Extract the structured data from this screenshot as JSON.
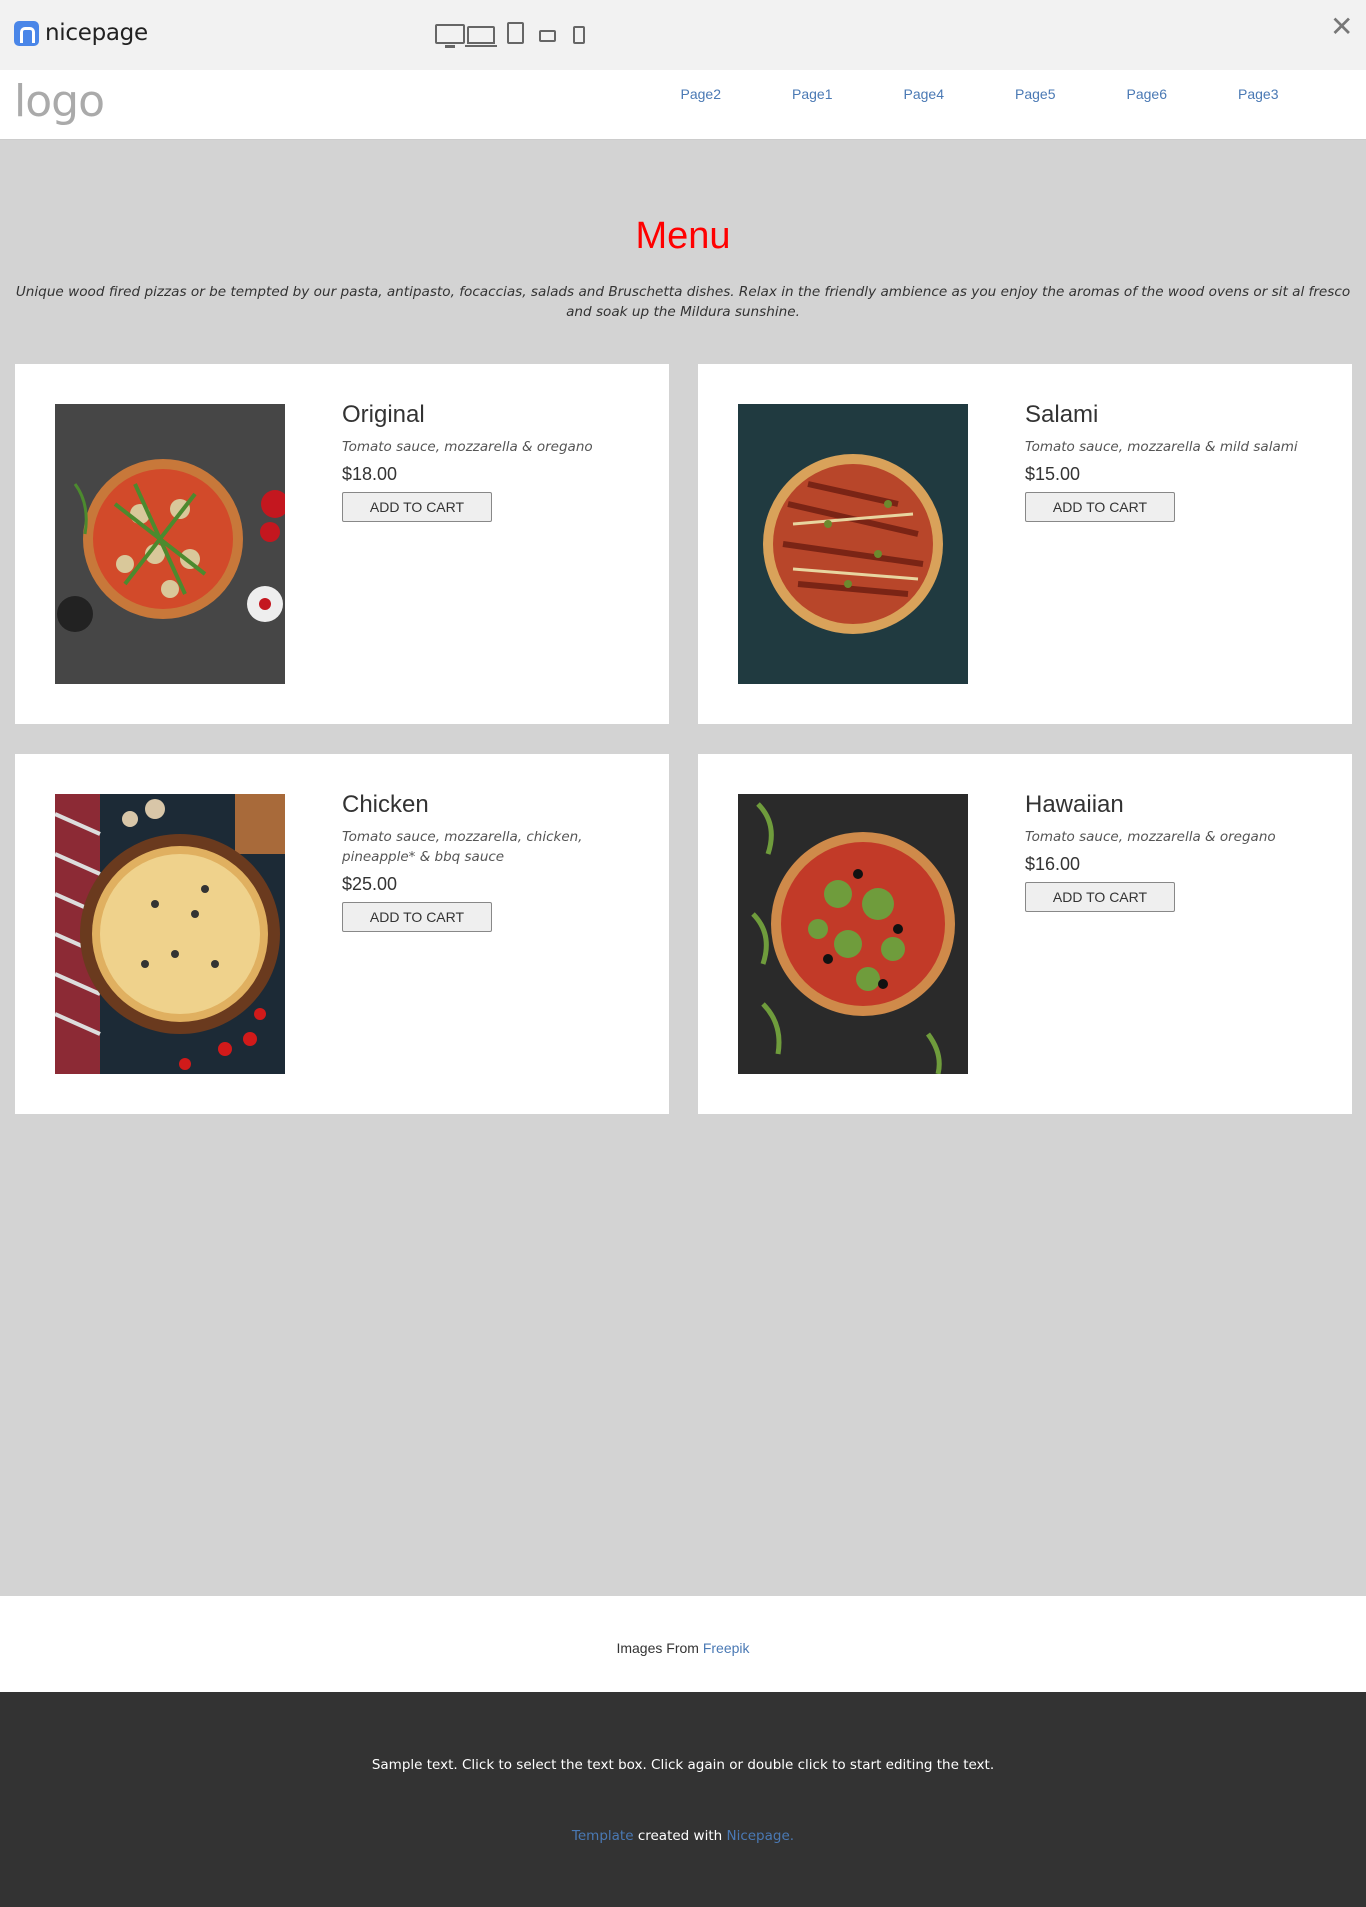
{
  "preview": {
    "brand": "nicepage",
    "devices": [
      "desktop-icon",
      "laptop-icon",
      "tablet-icon",
      "tablet-landscape-icon",
      "phone-icon"
    ],
    "close_glyph": "✕"
  },
  "header": {
    "logo": "logo",
    "nav": [
      "Page2",
      "Page1",
      "Page4",
      "Page5",
      "Page6",
      "Page3"
    ]
  },
  "menu": {
    "title": "Menu",
    "description": "Unique wood fired pizzas or be tempted by our pasta, antipasto, focaccias, salads and Bruschetta dishes. Relax in the friendly ambience as you enjoy the aromas of the wood ovens or sit al fresco and soak up the Mildura sunshine.",
    "items": [
      {
        "name": "Original",
        "ingredients": "Tomato sauce, mozzarella & oregano",
        "price": "$18.00",
        "button": "ADD TO CART"
      },
      {
        "name": "Salami",
        "ingredients": "Tomato sauce, mozzarella & mild salami",
        "price": "$15.00",
        "button": "ADD TO CART"
      },
      {
        "name": "Chicken",
        "ingredients": "Tomato sauce, mozzarella, chicken, pineapple* & bbq sauce",
        "price": "$25.00",
        "button": "ADD TO CART"
      },
      {
        "name": "Hawaiian",
        "ingredients": "Tomato sauce, mozzarella & oregano",
        "price": "$16.00",
        "button": "ADD TO CART"
      }
    ]
  },
  "credit": {
    "prefix": "Images From",
    "link": "Freepik"
  },
  "footer": {
    "sample": "Sample text. Click to select the text box. Click again or double click to start editing the text.",
    "template_link": "Template",
    "created_with": "created with",
    "nicepage_link": "Nicepage."
  },
  "colors": {
    "accent_title": "#ff0000",
    "link": "#4a79b4",
    "footer_bg": "#333333",
    "section_bg": "#d3d3d3"
  }
}
